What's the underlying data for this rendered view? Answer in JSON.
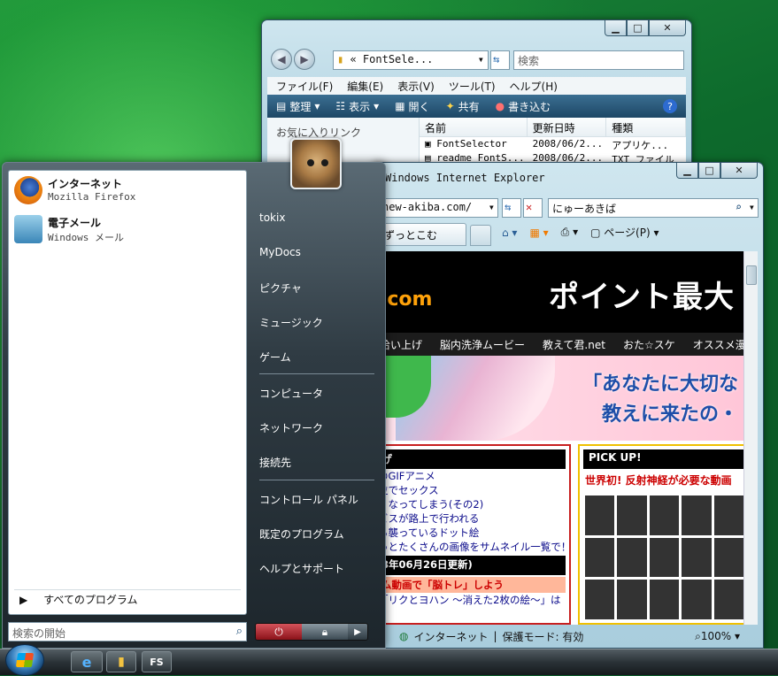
{
  "explorer": {
    "address": "« FontSele...",
    "search_placeholder": "検索",
    "menu": [
      "ファイル(F)",
      "編集(E)",
      "表示(V)",
      "ツール(T)",
      "ヘルプ(H)"
    ],
    "commands": [
      "整理",
      "表示",
      "開く",
      "共有",
      "書き込む"
    ],
    "favorites_label": "お気に入りリンク",
    "columns": [
      "名前",
      "更新日時",
      "種類"
    ],
    "rows": [
      {
        "name": "FontSelector",
        "date": "2008/06/2...",
        "type": "アプリケ..."
      },
      {
        "name": "readme_FontS...",
        "date": "2008/06/2...",
        "type": "TXT ファイル"
      }
    ]
  },
  "ie": {
    "title": "Windows Internet Explorer",
    "address": "new-akiba.com/",
    "search_text": "にゅーあきば",
    "tab_label": "ずっとこむ",
    "page_menu": "ページ(P)",
    "status_zone": "インターネット",
    "status_mode": "保護モード: 有効",
    "zoom": "100%",
    "page": {
      "banner_text": "ポイント最大",
      "banner_domain": ".com",
      "nav": [
        "拾い上げ",
        "脳内洗浄ムービー",
        "教えて君.net",
        "おた☆スケ",
        "オススメ漫"
      ],
      "hero_line1": "「あなたに大切な",
      "hero_line2": "教えに来たの・",
      "left_header": "げ",
      "left_links": [
        "のGIFアニメ",
        "位でセックス",
        "くなってしまう(その2)",
        "ビスが路上で行われる",
        "ら襲っているドット絵",
        "っとたくさんの画像をサムネイル一覧で！"
      ],
      "left_header2": "8年06月26日更新)",
      "left_pink": "ム動画で「脳トレ」しよう",
      "left_last": "「リクとヨハン ～消えた2枚の絵～」は",
      "pickup_header": "PICK UP!",
      "pickup_sub": "世界初! 反射神経が必要な動画"
    }
  },
  "startmenu": {
    "pinned": [
      {
        "title": "インターネット",
        "subtitle": "Mozilla Firefox"
      },
      {
        "title": "電子メール",
        "subtitle": "Windows メール"
      }
    ],
    "all_programs": "すべてのプログラム",
    "search_placeholder": "検索の開始",
    "right_items": [
      "tokix",
      "MyDocs",
      "ピクチャ",
      "ミュージック",
      "ゲーム",
      "コンピュータ",
      "ネットワーク",
      "接続先",
      "コントロール パネル",
      "既定のプログラム",
      "ヘルプとサポート"
    ]
  },
  "taskbar": {
    "fs_label": "FS"
  }
}
